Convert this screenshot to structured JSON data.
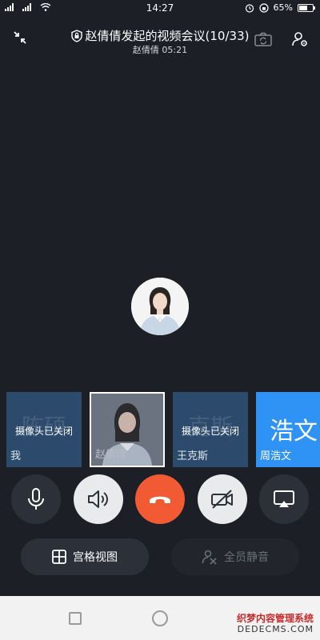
{
  "status_bar": {
    "time": "14:27",
    "battery": "65%",
    "battery_level": 0.65
  },
  "header": {
    "title": "赵倩倩发起的视频会议(10/33)",
    "host_line": "赵倩倩 05:21"
  },
  "thumbnails": [
    {
      "bg_name": "陈硕",
      "cam_status": "摄像头已关闭",
      "name": "我"
    },
    {
      "name": "赵倩倩"
    },
    {
      "bg_name": "克斯",
      "cam_status": "摄像头已关闭",
      "name": "王克斯"
    },
    {
      "big": "浩文",
      "name": "周浩文"
    }
  ],
  "controls": {
    "grid_view": "宫格视图",
    "mute_all": "全员静音"
  },
  "watermark": {
    "line1": "织梦内容管理系统",
    "line2": "DEDECMS.COM"
  },
  "colors": {
    "background": "#1c1f26",
    "hangup": "#f25a33",
    "active_tile": "#2f93f5"
  }
}
